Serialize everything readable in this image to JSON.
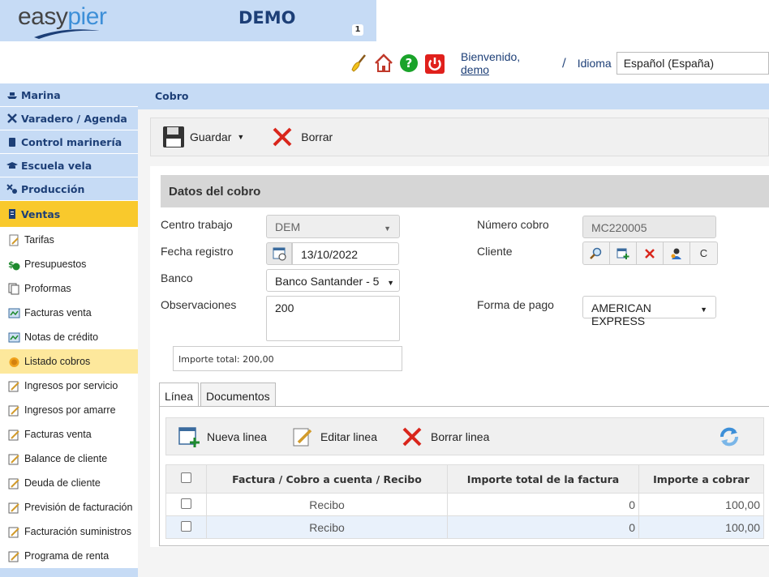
{
  "header": {
    "logo_part1": "easy",
    "logo_part2": "pier",
    "title": "DEMO",
    "badge": "1",
    "welcome_text": "Bienvenido,",
    "username": "demo",
    "separator": "/",
    "language_label": "Idioma",
    "language_value": "Español (España)",
    "icons": [
      "broom-icon",
      "home-icon",
      "help-icon",
      "power-icon"
    ]
  },
  "sidebar": {
    "sections": [
      {
        "label": "Marina",
        "icon": "ship-icon"
      },
      {
        "label": "Varadero / Agenda",
        "icon": "tools-icon"
      },
      {
        "label": "Control marinería",
        "icon": "clipboard-icon"
      },
      {
        "label": "Escuela vela",
        "icon": "graduation-cap-icon"
      },
      {
        "label": "Producción",
        "icon": "production-icon"
      }
    ],
    "active_section": {
      "label": "Ventas",
      "icon": "receipt-icon"
    },
    "items": [
      {
        "label": "Tarifas",
        "icon": "document-icon"
      },
      {
        "label": "Presupuestos",
        "icon": "money-icon"
      },
      {
        "label": "Proformas",
        "icon": "pages-icon"
      },
      {
        "label": "Facturas venta",
        "icon": "invoice-icon"
      },
      {
        "label": "Notas de crédito",
        "icon": "invoice-icon"
      },
      {
        "label": "Listado cobros",
        "icon": "coins-icon",
        "selected": true
      },
      {
        "label": "Ingresos por servicio",
        "icon": "report-icon"
      },
      {
        "label": "Ingresos por amarre",
        "icon": "report-icon"
      },
      {
        "label": "Facturas venta",
        "icon": "report-icon"
      },
      {
        "label": "Balance de cliente",
        "icon": "report-icon"
      },
      {
        "label": "Deuda de cliente",
        "icon": "report-icon"
      },
      {
        "label": "Previsión de facturación",
        "icon": "report-icon"
      },
      {
        "label": "Facturación suministros",
        "icon": "report-icon"
      },
      {
        "label": "Programa de renta",
        "icon": "report-icon"
      }
    ]
  },
  "main": {
    "page_title": "Cobro",
    "toolbar": {
      "save_label": "Guardar",
      "delete_label": "Borrar"
    },
    "section_title": "Datos del cobro",
    "form": {
      "centro_label": "Centro trabajo",
      "centro_value": "DEM",
      "fecha_label": "Fecha registro",
      "fecha_value": "13/10/2022",
      "banco_label": "Banco",
      "banco_value": "Banco Santander - 5",
      "obs_label": "Observaciones",
      "obs_value": "200",
      "numero_label": "Número cobro",
      "numero_value": "MC220005",
      "cliente_label": "Cliente",
      "cliente_extra": "C",
      "forma_label": "Forma de pago",
      "forma_value": "AMERICAN EXPRESS",
      "importe_total": "Importe total: 200,00"
    },
    "tabs": [
      {
        "label": "Línea"
      },
      {
        "label": "Documentos"
      }
    ],
    "line_toolbar": {
      "new": "Nueva linea",
      "edit": "Editar linea",
      "delete": "Borrar linea"
    },
    "table": {
      "headers": [
        "Factura / Cobro a cuenta / Recibo",
        "Importe total de la factura",
        "Importe a cobrar"
      ],
      "rows": [
        {
          "tipo": "Recibo",
          "total": "0",
          "cobrar": "100,00"
        },
        {
          "tipo": "Recibo",
          "total": "0",
          "cobrar": "100,00"
        }
      ]
    }
  }
}
